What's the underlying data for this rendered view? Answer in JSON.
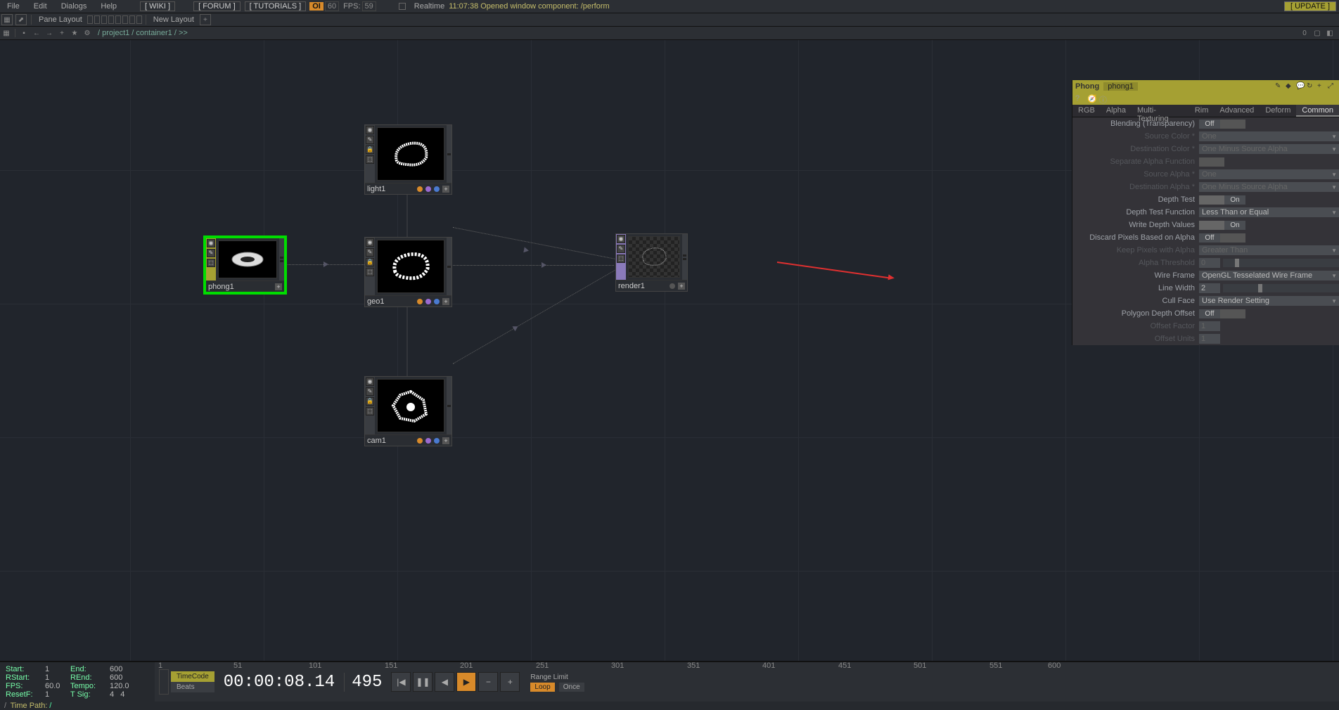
{
  "menu": {
    "file": "File",
    "edit": "Edit",
    "dialogs": "Dialogs",
    "help": "Help",
    "wiki": "[ WIKI ]",
    "forum": "[ FORUM ]",
    "tutorials": "[ TUTORIALS ]",
    "oi": "OI",
    "fps_target": "60",
    "fps_label": "FPS:",
    "fps_value": "59",
    "realtime": "Realtime",
    "status": "11:07:38 Opened window component: /perform",
    "update": "[ UPDATE ]"
  },
  "toolbar2": {
    "pane_layout": "Pane Layout",
    "new_layout": "New Layout"
  },
  "path": {
    "text": "/ project1 / container1 / >>"
  },
  "nodes": {
    "phong1": "phong1",
    "light1": "light1",
    "geo1": "geo1",
    "cam1": "cam1",
    "render1": "render1"
  },
  "panel": {
    "type": "Phong",
    "name": "phong1",
    "tabs": {
      "rgb": "RGB",
      "alpha": "Alpha",
      "multitex": "Multi-Texturing",
      "rim": "Rim",
      "advanced": "Advanced",
      "deform": "Deform",
      "common": "Common"
    },
    "params": {
      "blending_label": "Blending (Transparency)",
      "blending_val": "Off",
      "src_color_label": "Source Color *",
      "src_color_val": "One",
      "dst_color_label": "Destination Color *",
      "dst_color_val": "One Minus Source Alpha",
      "sep_alpha_label": "Separate Alpha Function",
      "src_alpha_label": "Source Alpha *",
      "src_alpha_val": "One",
      "dst_alpha_label": "Destination Alpha *",
      "dst_alpha_val": "One Minus Source Alpha",
      "depth_test_label": "Depth Test",
      "depth_test_val": "On",
      "depth_func_label": "Depth Test Function",
      "depth_func_val": "Less Than or Equal",
      "write_depth_label": "Write Depth Values",
      "write_depth_val": "On",
      "discard_alpha_label": "Discard Pixels Based on Alpha",
      "discard_alpha_val": "Off",
      "keep_alpha_label": "Keep Pixels with Alpha",
      "keep_alpha_val": "Greater Than",
      "alpha_thresh_label": "Alpha Threshold",
      "alpha_thresh_val": "0",
      "wireframe_label": "Wire Frame",
      "wireframe_val": "OpenGL Tesselated Wire Frame",
      "linewidth_label": "Line Width",
      "linewidth_val": "2",
      "cullface_label": "Cull Face",
      "cullface_val": "Use Render Setting",
      "polyoffset_label": "Polygon Depth Offset",
      "polyoffset_val": "Off",
      "offset_factor_label": "Offset Factor",
      "offset_factor_val": "1",
      "offset_units_label": "Offset Units",
      "offset_units_val": "1"
    }
  },
  "timeline": {
    "ticks": [
      "1",
      "51",
      "101",
      "151",
      "201",
      "251",
      "301",
      "351",
      "401",
      "451",
      "501",
      "551",
      "600"
    ],
    "start_lbl": "Start:",
    "start_val": "1",
    "end_lbl": "End:",
    "end_val": "600",
    "rstart_lbl": "RStart:",
    "rstart_val": "1",
    "rend_lbl": "REnd:",
    "rend_val": "600",
    "fps_lbl": "FPS:",
    "fps_val": "60.0",
    "tempo_lbl": "Tempo:",
    "tempo_val": "120.0",
    "resetf_lbl": "ResetF:",
    "resetf_val": "1",
    "tsig_lbl": "T Sig:",
    "tsig_v1": "4",
    "tsig_v2": "4",
    "timecode_btn": "TimeCode",
    "beats_btn": "Beats",
    "timecode": "00:00:08.14",
    "frame": "495",
    "range_limit": "Range Limit",
    "loop": "Loop",
    "once": "Once",
    "timepath_lbl": "Time Path:",
    "timepath_val": "/"
  }
}
